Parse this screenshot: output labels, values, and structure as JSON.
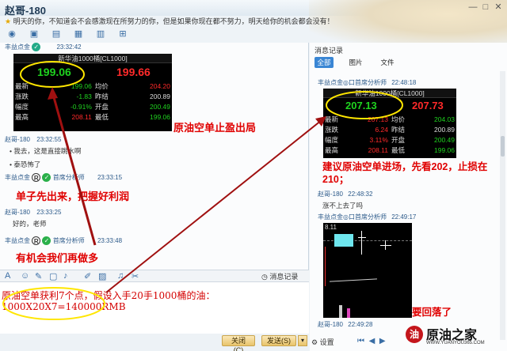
{
  "window": {
    "title": "赵哥-180"
  },
  "motto": "明天的你，不知道会不会感激现在所努力的你，但是如果你现在都不努力，明天给你的机会都会没有！",
  "toolbar": {
    "icons": [
      "voice-icon",
      "video-icon",
      "screen-share-icon",
      "file-transfer-icon",
      "remote-icon",
      "apps-icon"
    ]
  },
  "chat": {
    "m1": {
      "sender": "丰益点金",
      "time": "23:32:42"
    },
    "quote1": {
      "header": "新华油1000桶[CL1000]",
      "price_left": "199.06",
      "price_right": "199.66",
      "rows": [
        {
          "l": "最新",
          "v": "199.06",
          "k": "均价",
          "r": "204.20"
        },
        {
          "l": "涨跌",
          "v": "-1.83",
          "k": "昨结",
          "r": "200.89"
        },
        {
          "l": "幅度",
          "v": "-0.91%",
          "k": "开盘",
          "r": "200.49"
        },
        {
          "l": "最高",
          "v": "208.11",
          "k": "最低",
          "r": "199.06"
        }
      ]
    },
    "caption1": "原油空单止盈出局",
    "m2": {
      "sender": "赵哥-180",
      "time": "23:32:55"
    },
    "m2_lines": [
      "我去，这是直接跳水啊",
      "泰恐怖了"
    ],
    "m3": {
      "sender": "丰益点金",
      "role": "首席分析师",
      "time": "23:33:15"
    },
    "m3_text": "单子先出来，把握好利润",
    "m4": {
      "sender": "赵哥-180",
      "time": "23:33:25"
    },
    "m4_text": "好的，老师",
    "m5": {
      "sender": "丰益点金",
      "role": "首席分析师",
      "time": "23:33:48"
    },
    "m5_text": "有机会我们再做多"
  },
  "input_bar": {
    "history": "消息记录"
  },
  "input": {
    "line1": "原油空单获利7个点，假设入手20手1000桶的油：",
    "line2": "1000X20X7=140000RMB"
  },
  "footer": {
    "close": "关闭(C)",
    "send": "发送(S)"
  },
  "right": {
    "title": "消息记录",
    "tabs": [
      "全部",
      "图片",
      "文件"
    ],
    "r1": {
      "sender": "丰益点金◎口首席分析师",
      "time": "22:48:18"
    },
    "quote2": {
      "header": "新华油1000桶[CL1000]",
      "price_left": "207.13",
      "price_right": "207.73",
      "rows": [
        {
          "l": "最新",
          "v": "207.13",
          "k": "均价",
          "r": "204.03"
        },
        {
          "l": "涨跌",
          "v": "6.24",
          "k": "昨结",
          "r": "200.89"
        },
        {
          "l": "幅度",
          "v": "3.11%",
          "k": "开盘",
          "r": "200.49"
        },
        {
          "l": "最高",
          "v": "208.11",
          "k": "最低",
          "r": "199.06"
        }
      ]
    },
    "caption2": "建议原油空单进场，先看202，止损在210；",
    "r2": {
      "sender": "赵哥-180",
      "time": "22:48:32"
    },
    "r2_text": "涨不上去了吗",
    "r3": {
      "sender": "丰益点金◎口首席分析师",
      "time": "22:49:17"
    },
    "chart_label": "8.11",
    "caption3": "要回落了",
    "r4": {
      "sender": "赵哥-180",
      "time": "22:49:28"
    },
    "settings": "设置"
  },
  "watermark": {
    "name": "原油之家",
    "url": "WWW.YUANYOU365.COM"
  },
  "colors": {
    "annotation": "#e00000",
    "highlight": "#ffe600",
    "quote_green": "#1fd31f",
    "quote_red": "#ff2a2a"
  }
}
